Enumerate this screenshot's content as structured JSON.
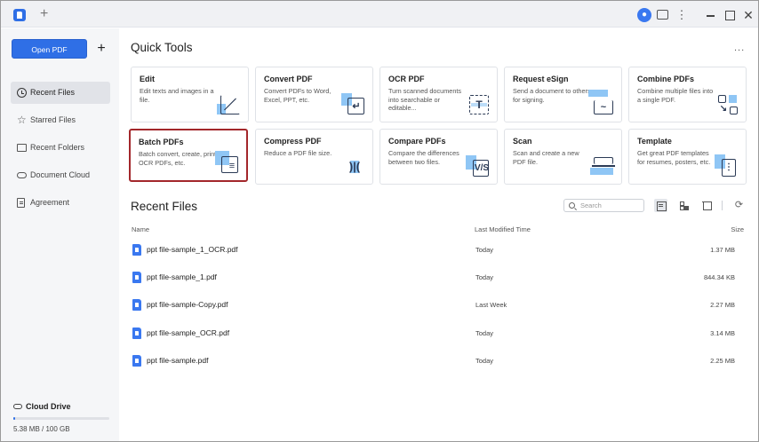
{
  "sidebar": {
    "open_pdf": "Open PDF",
    "add": "+",
    "items": [
      {
        "label": "Recent Files",
        "icon": "clock-icon",
        "active": true
      },
      {
        "label": "Starred Files",
        "icon": "star-icon"
      },
      {
        "label": "Recent Folders",
        "icon": "folder-icon"
      },
      {
        "label": "Document Cloud",
        "icon": "cloud-icon"
      },
      {
        "label": "Agreement",
        "icon": "agreement-icon"
      }
    ],
    "cloud_drive": "Cloud Drive",
    "storage": "5.38 MB / 100 GB",
    "storage_used_fraction": 0.02
  },
  "quick_tools": {
    "title": "Quick Tools",
    "more": "...",
    "tools": [
      {
        "title": "Edit",
        "desc": "Edit texts and images in a file.",
        "icon": "edit-icon"
      },
      {
        "title": "Convert PDF",
        "desc": "Convert PDFs to Word, Excel, PPT, etc.",
        "icon": "convert-icon"
      },
      {
        "title": "OCR PDF",
        "desc": "Turn scanned documents into searchable or editable...",
        "icon": "ocr-icon"
      },
      {
        "title": "Request eSign",
        "desc": "Send a document to others for signing.",
        "icon": "esign-icon"
      },
      {
        "title": "Combine PDFs",
        "desc": "Combine multiple files into a single PDF.",
        "icon": "combine-icon"
      },
      {
        "title": "Batch PDFs",
        "desc": "Batch convert, create, print, OCR PDFs, etc.",
        "icon": "batch-icon"
      },
      {
        "title": "Compress PDF",
        "desc": "Reduce a PDF file size.",
        "icon": "compress-icon"
      },
      {
        "title": "Compare PDFs",
        "desc": "Compare the differences between two files.",
        "icon": "compare-icon"
      },
      {
        "title": "Scan",
        "desc": "Scan and create a new PDF file.",
        "icon": "scan-icon"
      },
      {
        "title": "Template",
        "desc": "Get great PDF templates for resumes, posters, etc.",
        "icon": "template-icon"
      }
    ]
  },
  "recent_files": {
    "title": "Recent Files",
    "search_placeholder": "Search",
    "columns": {
      "name": "Name",
      "modified": "Last Modified Time",
      "size": "Size"
    },
    "rows": [
      {
        "name": "ppt file-sample_1_OCR.pdf",
        "modified": "Today",
        "size": "1.37 MB"
      },
      {
        "name": "ppt file-sample_1.pdf",
        "modified": "Today",
        "size": "844.34 KB"
      },
      {
        "name": "ppt file-sample-Copy.pdf",
        "modified": "Last Week",
        "size": "2.27 MB"
      },
      {
        "name": "ppt file-sample_OCR.pdf",
        "modified": "Today",
        "size": "3.14 MB"
      },
      {
        "name": "ppt file-sample.pdf",
        "modified": "Today",
        "size": "2.25 MB"
      }
    ]
  },
  "colors": {
    "accent": "#2f6fe6",
    "selected_border": "#a3272b"
  }
}
